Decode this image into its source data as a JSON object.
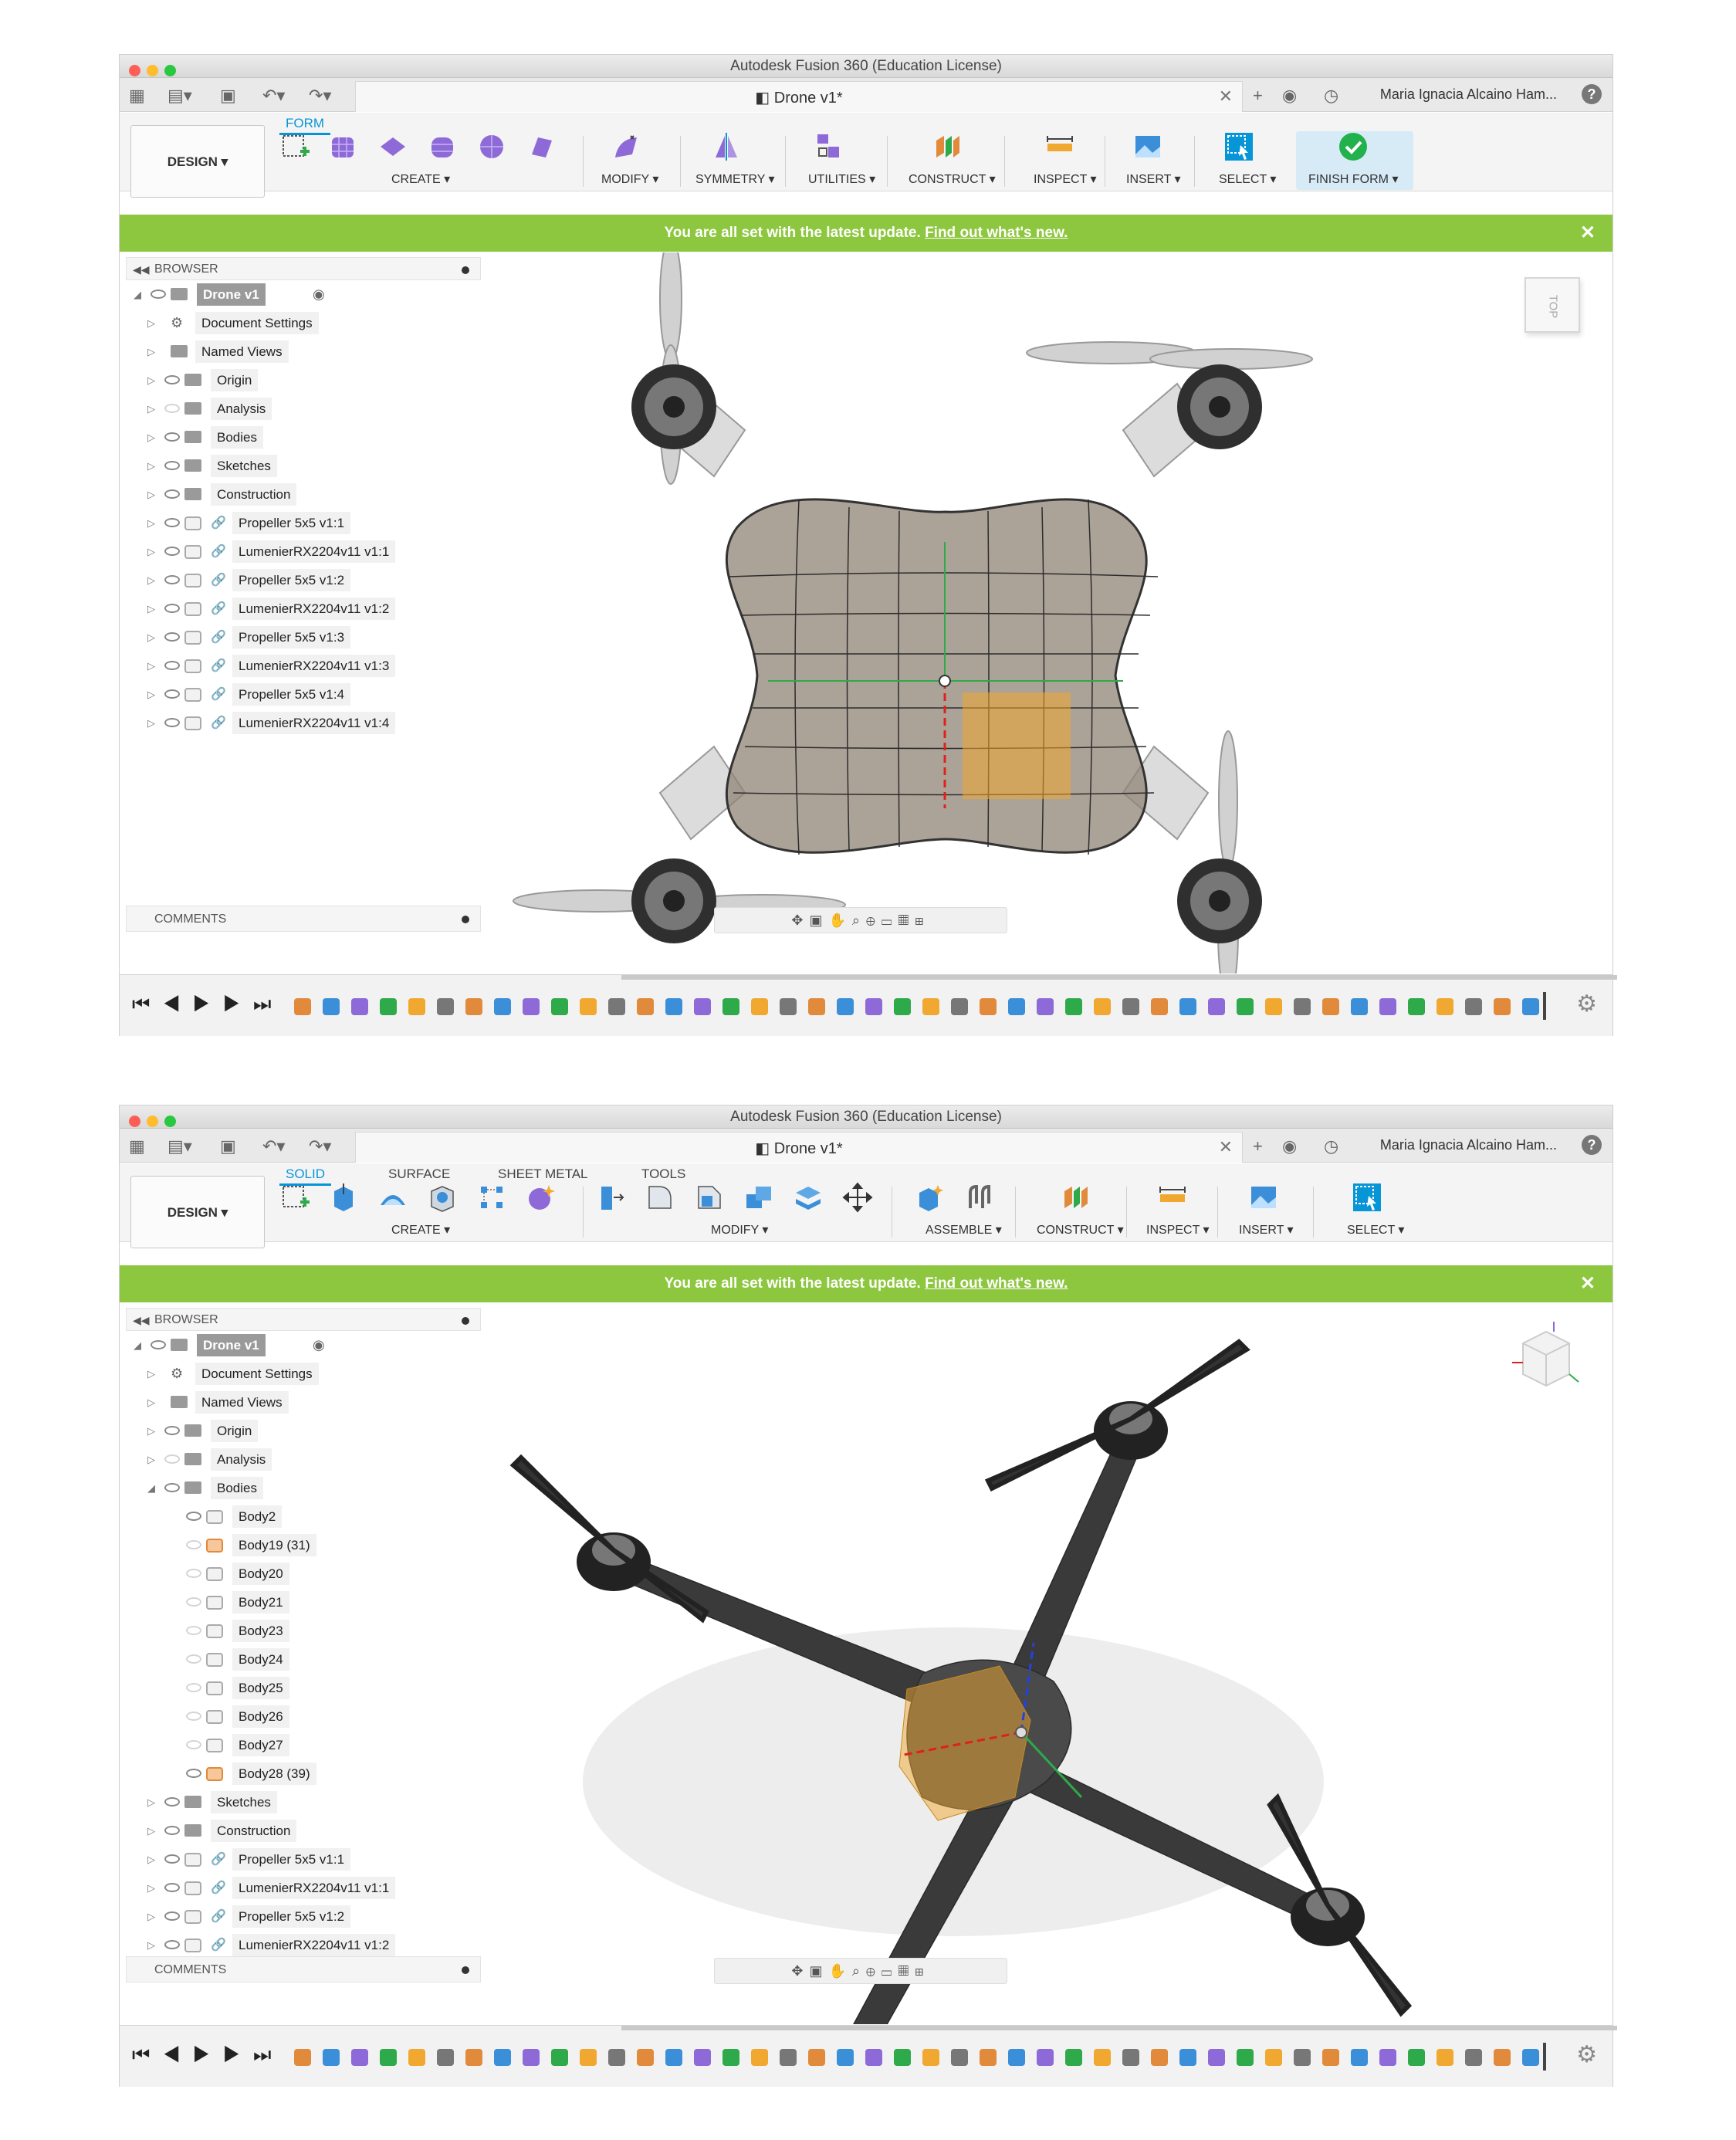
{
  "app_title": "Autodesk Fusion 360 (Education License)",
  "document_tab": "Drone v1*",
  "user_name": "Maria Ignacia Alcaino Ham...",
  "help_label": "?",
  "design_label": "DESIGN ▾",
  "banner": {
    "text": "You are all set with the latest update.",
    "link": "Find out what's new."
  },
  "browser_label": "BROWSER",
  "comments_label": "COMMENTS",
  "view_cube": {
    "top": "TOP"
  },
  "window1": {
    "tabs": [
      "FORM"
    ],
    "groups": [
      "CREATE ▾",
      "MODIFY ▾",
      "SYMMETRY ▾",
      "UTILITIES ▾",
      "CONSTRUCT ▾",
      "INSPECT ▾",
      "INSERT ▾",
      "SELECT ▾",
      "FINISH FORM ▾"
    ],
    "tree": [
      {
        "label": "Drone v1",
        "level": 0,
        "type": "root"
      },
      {
        "label": "Document Settings",
        "level": 1,
        "type": "gear"
      },
      {
        "label": "Named Views",
        "level": 1,
        "type": "folder-noeye"
      },
      {
        "label": "Origin",
        "level": 1,
        "type": "folder"
      },
      {
        "label": "Analysis",
        "level": 1,
        "type": "folder-off"
      },
      {
        "label": "Bodies",
        "level": 1,
        "type": "folder"
      },
      {
        "label": "Sketches",
        "level": 1,
        "type": "folder"
      },
      {
        "label": "Construction",
        "level": 1,
        "type": "folder"
      },
      {
        "label": "Propeller 5x5 v1:1",
        "level": 1,
        "type": "link"
      },
      {
        "label": "LumenierRX2204v11 v1:1",
        "level": 1,
        "type": "link"
      },
      {
        "label": "Propeller 5x5 v1:2",
        "level": 1,
        "type": "link"
      },
      {
        "label": "LumenierRX2204v11 v1:2",
        "level": 1,
        "type": "link"
      },
      {
        "label": "Propeller 5x5 v1:3",
        "level": 1,
        "type": "link"
      },
      {
        "label": "LumenierRX2204v11 v1:3",
        "level": 1,
        "type": "link"
      },
      {
        "label": "Propeller 5x5 v1:4",
        "level": 1,
        "type": "link"
      },
      {
        "label": "LumenierRX2204v11 v1:4",
        "level": 1,
        "type": "link"
      }
    ]
  },
  "window2": {
    "tabs": [
      "SOLID",
      "SURFACE",
      "SHEET METAL",
      "TOOLS"
    ],
    "groups": [
      "CREATE ▾",
      "MODIFY ▾",
      "ASSEMBLE ▾",
      "CONSTRUCT ▾",
      "INSPECT ▾",
      "INSERT ▾",
      "SELECT ▾"
    ],
    "tree": [
      {
        "label": "Drone v1",
        "level": 0,
        "type": "root"
      },
      {
        "label": "Document Settings",
        "level": 1,
        "type": "gear"
      },
      {
        "label": "Named Views",
        "level": 1,
        "type": "folder-noeye"
      },
      {
        "label": "Origin",
        "level": 1,
        "type": "folder"
      },
      {
        "label": "Analysis",
        "level": 1,
        "type": "folder-off"
      },
      {
        "label": "Bodies",
        "level": 1,
        "type": "folder-open"
      },
      {
        "label": "Body2",
        "level": 2,
        "type": "body"
      },
      {
        "label": "Body19 (31)",
        "level": 2,
        "type": "body-or-off"
      },
      {
        "label": "Body20",
        "level": 2,
        "type": "body-off"
      },
      {
        "label": "Body21",
        "level": 2,
        "type": "body-off"
      },
      {
        "label": "Body23",
        "level": 2,
        "type": "body-off"
      },
      {
        "label": "Body24",
        "level": 2,
        "type": "body-off"
      },
      {
        "label": "Body25",
        "level": 2,
        "type": "body-off"
      },
      {
        "label": "Body26",
        "level": 2,
        "type": "body-off"
      },
      {
        "label": "Body27",
        "level": 2,
        "type": "body-off"
      },
      {
        "label": "Body28 (39)",
        "level": 2,
        "type": "body-or"
      },
      {
        "label": "Sketches",
        "level": 1,
        "type": "folder"
      },
      {
        "label": "Construction",
        "level": 1,
        "type": "folder"
      },
      {
        "label": "Propeller 5x5 v1:1",
        "level": 1,
        "type": "link"
      },
      {
        "label": "LumenierRX2204v11 v1:1",
        "level": 1,
        "type": "link"
      },
      {
        "label": "Propeller 5x5 v1:2",
        "level": 1,
        "type": "link"
      },
      {
        "label": "LumenierRX2204v11 v1:2",
        "level": 1,
        "type": "link"
      }
    ]
  },
  "colors": {
    "accent": "#0696d7",
    "banner": "#8dc63f",
    "form_tool": "#8e6ad8",
    "finish": "#22b14c",
    "selection": "#f0a830"
  }
}
